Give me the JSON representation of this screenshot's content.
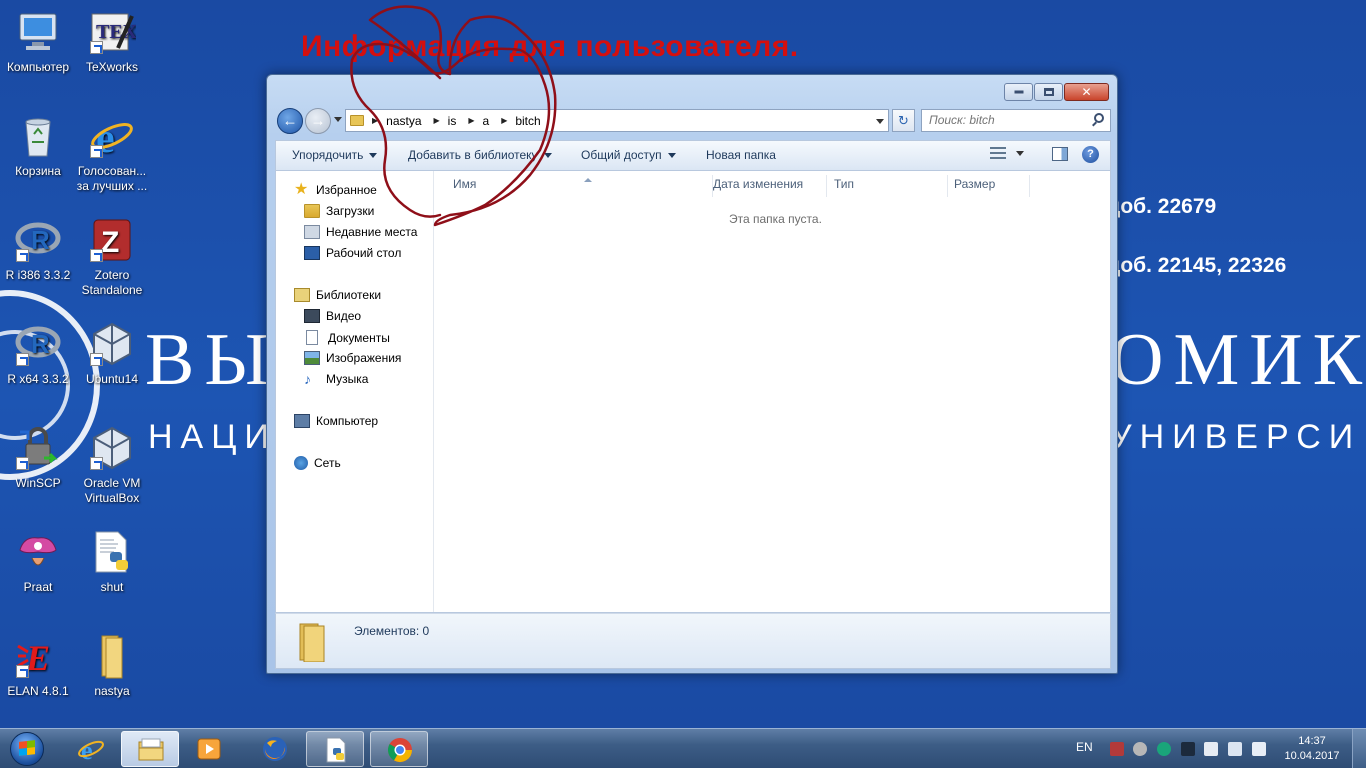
{
  "annotation": {
    "text": "Информация для пользователя."
  },
  "wallpaper": {
    "big_left": "ВЫ",
    "big_right": "ОМИК",
    "mid_left": "НАЦИ",
    "mid_right": "УНИВЕРСИ",
    "phone1": "доб. 22679",
    "phone2": "доб. 22145, 22326"
  },
  "desktop_icons": [
    {
      "label": "Компьютер"
    },
    {
      "label": "TeXworks"
    },
    {
      "label": "Корзина"
    },
    {
      "label": "Голосован... за лучших ..."
    },
    {
      "label": "R i386 3.3.2"
    },
    {
      "label": "Zotero Standalone"
    },
    {
      "label": "R x64 3.3.2"
    },
    {
      "label": "Ubuntu14"
    },
    {
      "label": "WinSCP"
    },
    {
      "label": "Oracle VM VirtualBox"
    },
    {
      "label": "Praat"
    },
    {
      "label": "shut"
    },
    {
      "label": "ELAN 4.8.1"
    },
    {
      "label": "nastya"
    }
  ],
  "explorer": {
    "breadcrumb": [
      "nastya",
      "is",
      "a",
      "bitch"
    ],
    "search_placeholder": "Поиск: bitch",
    "toolbar": {
      "organize": "Упорядочить",
      "add_to_library": "Добавить в библиотеку",
      "share": "Общий доступ",
      "new_folder": "Новая папка"
    },
    "nav": {
      "favorites": "Избранное",
      "downloads": "Загрузки",
      "recent": "Недавние места",
      "desktop": "Рабочий стол",
      "libraries": "Библиотеки",
      "video": "Видео",
      "documents": "Документы",
      "images": "Изображения",
      "music": "Музыка",
      "computer": "Компьютер",
      "network": "Сеть"
    },
    "columns": {
      "name": "Имя",
      "modified": "Дата изменения",
      "type": "Тип",
      "size": "Размер"
    },
    "empty_message": "Эта папка пуста.",
    "status": "Элементов: 0"
  },
  "taskbar": {
    "lang": "EN",
    "time": "14:37",
    "date": "10.04.2017"
  },
  "colors": {
    "desktop_bg": "#1d55b3",
    "annotation_red": "#d40f0f",
    "scribble": "#8f0f19"
  }
}
